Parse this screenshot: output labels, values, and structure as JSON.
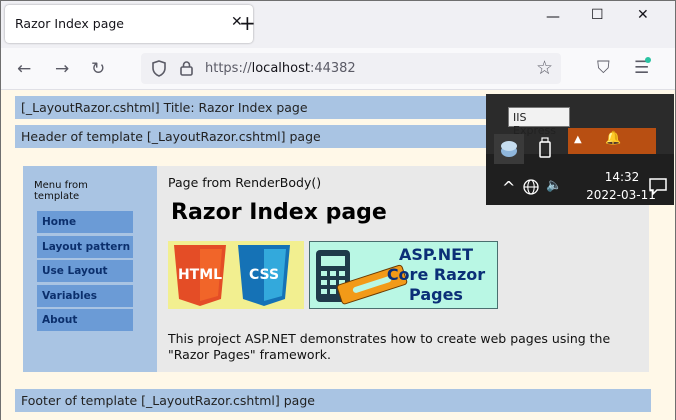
{
  "browser": {
    "tab_title": "Razor Index page",
    "tab_close": "✕",
    "new_tab": "+",
    "window_controls": {
      "minimize": "—",
      "maximize": "☐",
      "close": "✕"
    },
    "nav": {
      "back": "←",
      "forward": "→",
      "reload": "↻"
    },
    "url_scheme": "https://",
    "url_host": "localhost",
    "url_port": ":44382",
    "toolbar_icons": {
      "bookmark": "☆",
      "pocket": "⛉",
      "menu": "☰"
    }
  },
  "page": {
    "layout_title": "[_LayoutRazor.cshtml] Title: Razor Index page",
    "header": "Header of template [_LayoutRazor.cshtml] page",
    "menu_title": "Menu from template",
    "menu_items": [
      "Home",
      "Layout pattern",
      "Use Layout",
      "Variables",
      "About"
    ],
    "renderbody_label": "Page from RenderBody()",
    "heading": "Razor Index page",
    "logos": {
      "html_label": "HTML",
      "css_label": "CSS",
      "asp_text": "ASP.NET Core Razor Pages"
    },
    "description": "This project ASP.NET demonstrates how to create web pages using the \"Razor Pages\" framework.",
    "footer": "Footer of template [_LayoutRazor.cshtml] page"
  },
  "taskbar": {
    "tooltip": "IIS Express",
    "time": "14:32",
    "date": "2022-03-11",
    "chevron": "^",
    "volume": "🔈"
  },
  "colors": {
    "band_blue": "#a9c4e3",
    "menu_button": "#6b9bd6",
    "page_background": "#fff8e8",
    "taskbar": "#1f1f1f",
    "tray_accent": "#b84f12"
  }
}
